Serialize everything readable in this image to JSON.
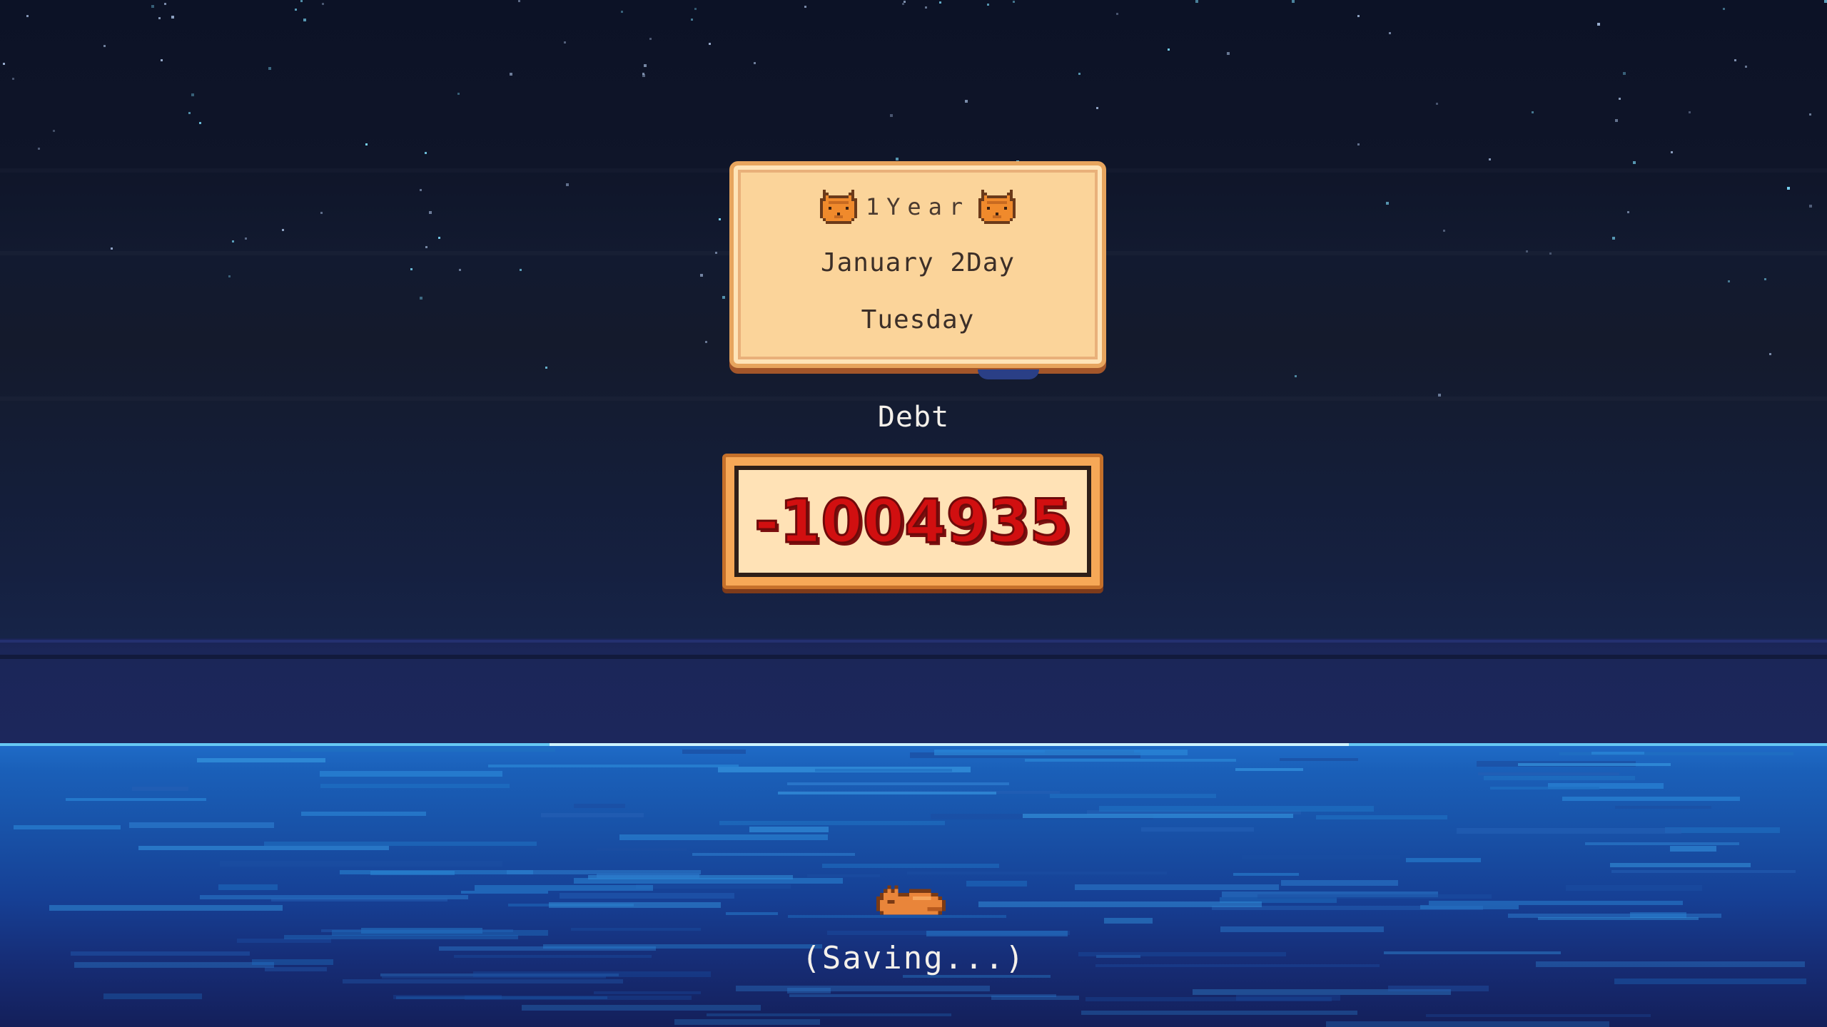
{
  "calendar": {
    "year": "1Year",
    "date": "January 2Day",
    "weekday": "Tuesday"
  },
  "debt": {
    "title": "Debt",
    "value": "-1004935"
  },
  "status": {
    "saving": "(Saving...)"
  },
  "icons": {
    "left": "cat-face-icon",
    "right": "cat-face-icon",
    "sleeper": "sleeping-cat-icon"
  },
  "colors": {
    "panel": "#fbd49a",
    "panel_border": "#e7a55e",
    "debt_text": "#d10f10",
    "sky": "#0c1226",
    "ocean": "#1a5fb8"
  }
}
